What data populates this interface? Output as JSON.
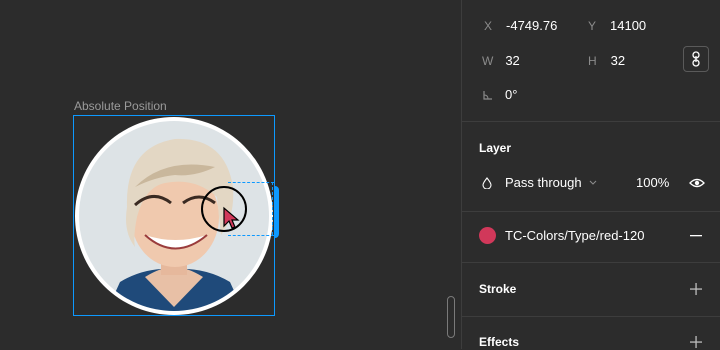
{
  "canvas": {
    "frame_label": "Absolute Position"
  },
  "design_panel": {
    "position": {
      "x_label": "X",
      "x_value": "-4749.76",
      "y_label": "Y",
      "y_value": "14100",
      "w_label": "W",
      "w_value": "32",
      "h_label": "H",
      "h_value": "32",
      "rotation_value": "0°"
    },
    "layer": {
      "title": "Layer",
      "blend_mode": "Pass through",
      "opacity": "100%"
    },
    "fill": {
      "color_name": "TC-Colors/Type/red-120",
      "swatch_color": "#d1385a"
    },
    "stroke": {
      "title": "Stroke"
    },
    "effects": {
      "title": "Effects"
    }
  },
  "colors": {
    "selection": "#0d99ff",
    "panel_bg": "#2c2c2c"
  }
}
